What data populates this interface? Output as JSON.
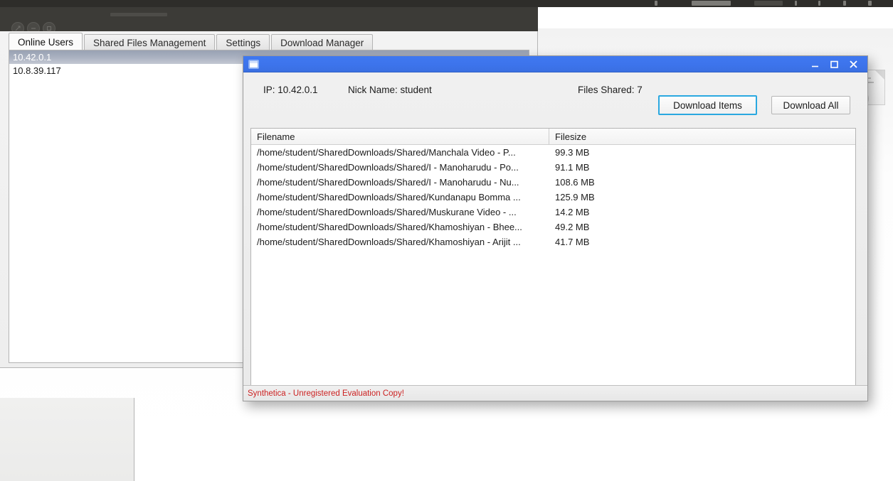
{
  "desktop": {
    "topbar": {
      "present": true,
      "color": "#2e2d2a"
    },
    "background_color": "#ffffff"
  },
  "background_window": {
    "title": "",
    "window_controls": [
      {
        "name": "close",
        "icon": "close-icon"
      },
      {
        "name": "minimize",
        "icon": "minimize-icon"
      },
      {
        "name": "maximize",
        "icon": "maximize-icon"
      }
    ],
    "tabs": [
      {
        "label": "Online Users",
        "active": true
      },
      {
        "label": "Shared Files Management",
        "active": false
      },
      {
        "label": "Settings",
        "active": false
      },
      {
        "label": "Download Manager",
        "active": false
      }
    ],
    "online_users": [
      {
        "ip": "10.42.0.1",
        "selected": true
      },
      {
        "ip": "10.8.39.117",
        "selected": false
      }
    ]
  },
  "dialog": {
    "title": "",
    "app_icon": "window-icon",
    "window_controls": {
      "minimize": "minimize-icon",
      "maximize": "maximize-icon",
      "close": "close-icon"
    },
    "toolbar": {
      "ip_label": "IP: 10.42.0.1",
      "nick_label": "Nick Name: student",
      "files_shared_label": "Files Shared: 7",
      "download_items_label": "Download Items",
      "download_all_label": "Download All",
      "focus_ring_color": "#2aa8e0"
    },
    "table": {
      "columns": [
        "Filename",
        "Filesize"
      ],
      "rows": [
        {
          "filename": "/home/student/SharedDownloads/Shared/Manchala Video - P...",
          "filesize": "99.3 MB"
        },
        {
          "filename": "/home/student/SharedDownloads/Shared/I - Manoharudu - Po...",
          "filesize": "91.1 MB"
        },
        {
          "filename": "/home/student/SharedDownloads/Shared/I - Manoharudu - Nu...",
          "filesize": "108.6 MB"
        },
        {
          "filename": "/home/student/SharedDownloads/Shared/Kundanapu Bomma ...",
          "filesize": "125.9 MB"
        },
        {
          "filename": "/home/student/SharedDownloads/Shared/Muskurane Video - ...",
          "filesize": "14.2 MB"
        },
        {
          "filename": "/home/student/SharedDownloads/Shared/Khamoshiyan - Bhee...",
          "filesize": "49.2 MB"
        },
        {
          "filename": "/home/student/SharedDownloads/Shared/Khamoshiyan - Arijit ...",
          "filesize": "41.7 MB"
        }
      ]
    },
    "statusbar": {
      "text": "Synthetica - Unregistered Evaluation Copy!",
      "color": "#cc2222"
    },
    "titlebar_color": "#3d74ec"
  }
}
